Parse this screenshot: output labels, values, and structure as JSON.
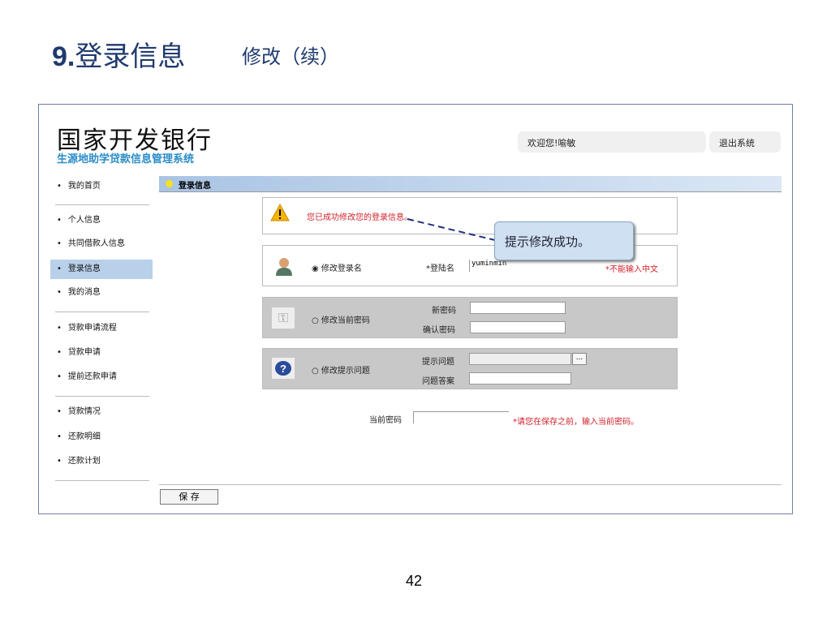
{
  "slide": {
    "title_num": "9.",
    "title": "登录信息",
    "subtitle": "修改（续）",
    "page": "42"
  },
  "header": {
    "bank": "国家开发银行",
    "system": "生源地助学贷款信息管理系统",
    "welcome": "欢迎您!喻敏",
    "logout": "退出系统"
  },
  "nav": [
    "我的首页",
    "个人信息",
    "共同借款人信息",
    "登录信息",
    "我的消息",
    "贷款申请流程",
    "贷款申请",
    "提前还款申请",
    "贷款情况",
    "还款明细",
    "还款计划"
  ],
  "section_title": "登录信息",
  "success_msg": "您已成功修改您的登录信息。",
  "callout": "提示修改成功。",
  "login_name": {
    "radio": "修改登录名",
    "label": "*登陆名",
    "value": "yuminmin",
    "hint": "*不能输入中文"
  },
  "password": {
    "radio": "修改当前密码",
    "new_label": "新密码",
    "confirm_label": "确认密码"
  },
  "question": {
    "radio": "修改提示问题",
    "q_label": "提示问题",
    "a_label": "问题答案",
    "more": "..."
  },
  "current_pwd": {
    "label": "当前密码",
    "hint": "*请您在保存之前，输入当前密码。"
  },
  "save": "保 存"
}
